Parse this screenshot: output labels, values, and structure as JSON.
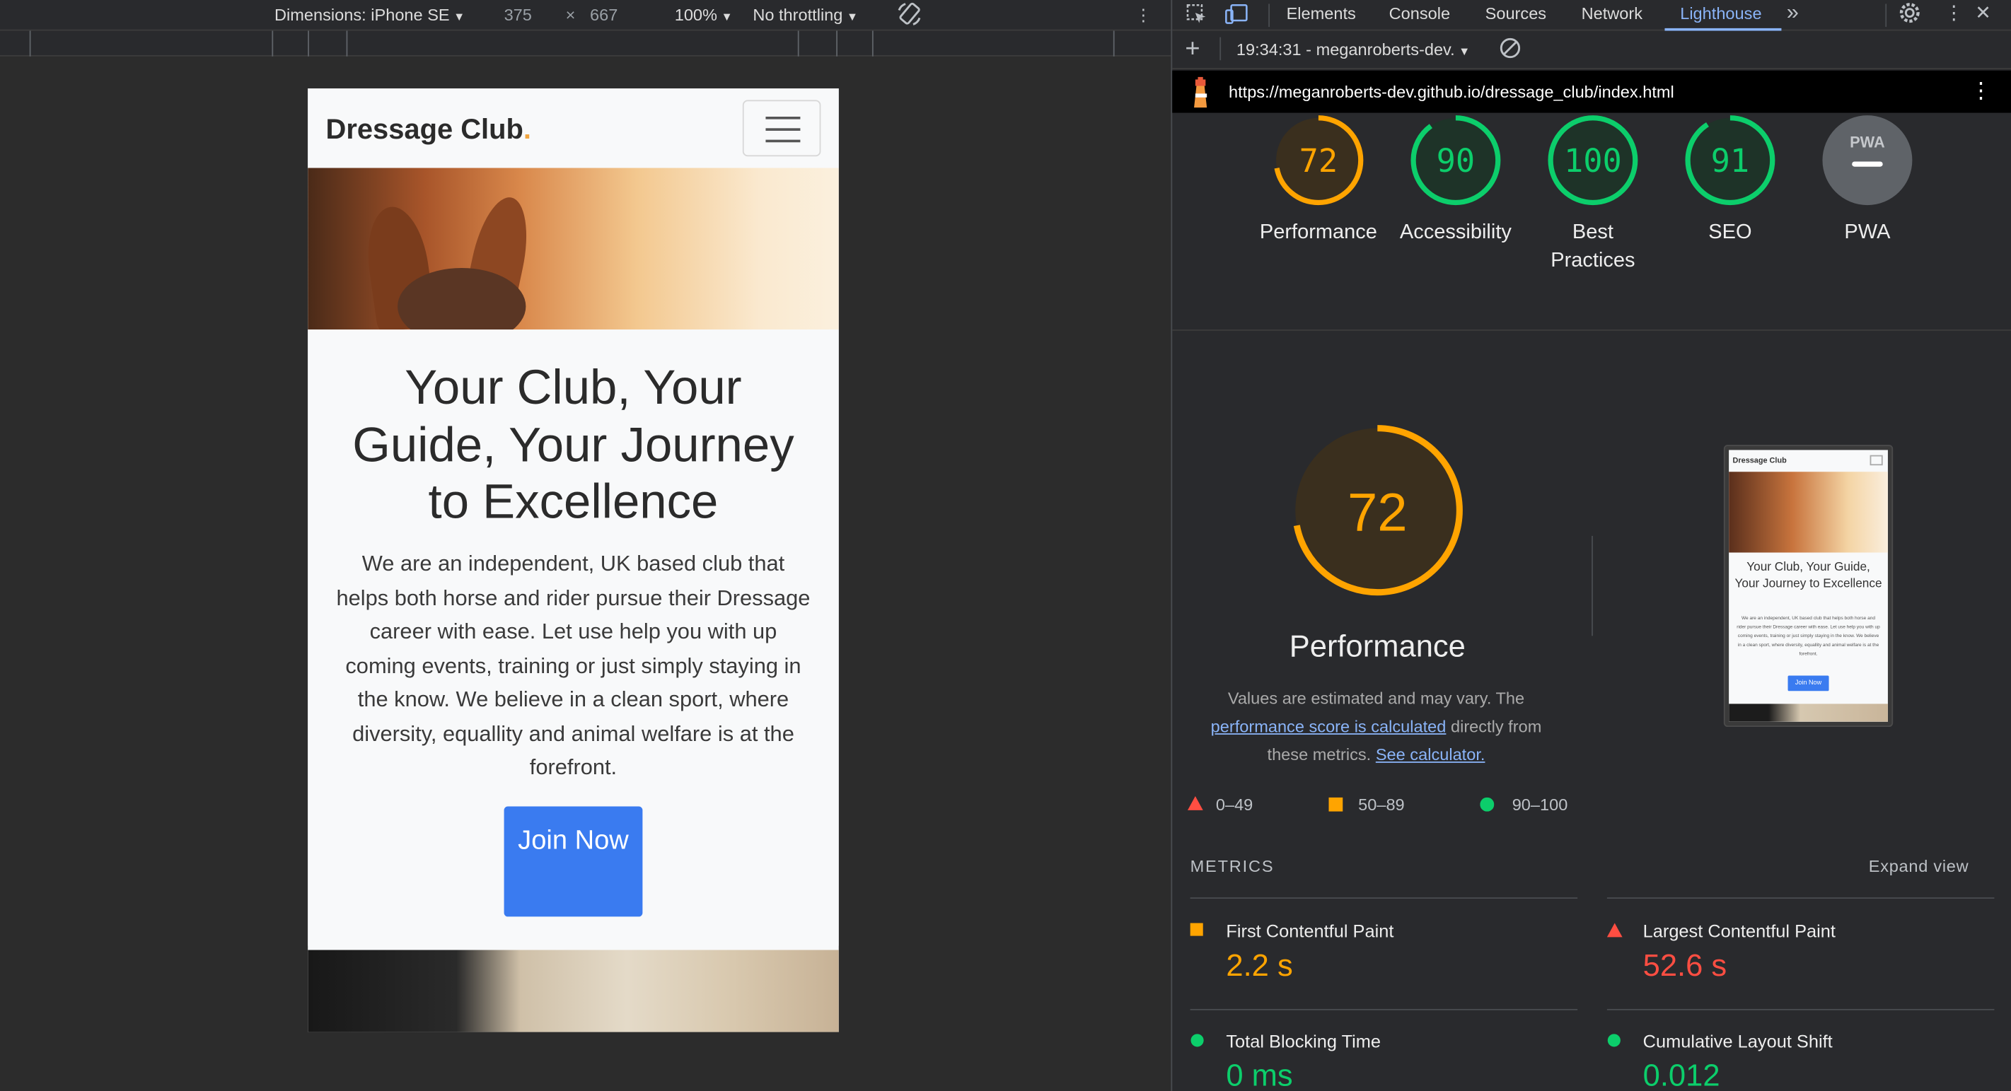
{
  "device_toolbar": {
    "dimensions_label": "Dimensions: iPhone SE",
    "width": "375",
    "times": "×",
    "height": "667",
    "zoom": "100%",
    "throttling": "No throttling"
  },
  "site": {
    "brand": "Dressage Club",
    "brand_dot": ".",
    "heading": "Your Club, Your Guide, Your Journey to Excellence",
    "intro": "We are an independent, UK based club that helps both horse and rider pursue their Dressage career with ease. Let use help you with up coming events, training or just simply staying in the know. We believe in a clean sport, where diversity, equallity and animal welfare is at the forefront.",
    "join_button": "Join Now"
  },
  "devtools": {
    "tabs": [
      "Elements",
      "Console",
      "Sources",
      "Network",
      "Lighthouse"
    ],
    "more_tabs": "»",
    "report_time": "19:34:31 - meganroberts-dev.",
    "url": "https://meganroberts-dev.github.io/dressage_club/index.html",
    "categories": [
      {
        "label": "Performance",
        "score": "72",
        "value": 72,
        "color": "#ffa400"
      },
      {
        "label": "Accessibility",
        "score": "90",
        "value": 90,
        "color": "#0cce6b"
      },
      {
        "label": "Best Practices",
        "score": "100",
        "value": 100,
        "color": "#0cce6b"
      },
      {
        "label": "SEO",
        "score": "91",
        "value": 91,
        "color": "#0cce6b"
      },
      {
        "label": "PWA",
        "score": "",
        "value": 0,
        "color": "#9aa0a6"
      }
    ],
    "pwa_badge": "PWA",
    "performance": {
      "score": "72",
      "value": 72,
      "title": "Performance",
      "desc_start": "Values are estimated and may vary. The",
      "desc_link": "performance score is calculated",
      "desc_mid": "directly from these metrics.",
      "desc_link2": "See calculator."
    },
    "thumbnail": {
      "brand": "Dressage Club",
      "heading": "Your Club, Your Guide, Your Journey to Excellence",
      "button": "Join Now"
    },
    "legend": [
      {
        "range": "0–49",
        "color": "#ff4e42",
        "shape": "triangle"
      },
      {
        "range": "50–89",
        "color": "#ffa400",
        "shape": "square"
      },
      {
        "range": "90–100",
        "color": "#0cce6b",
        "shape": "circle"
      }
    ],
    "metrics_heading": "METRICS",
    "expand_view": "Expand view",
    "metrics": [
      {
        "name": "First Contentful Paint",
        "value": "2.2 s",
        "color": "#ffa400",
        "shape": "square"
      },
      {
        "name": "Largest Contentful Paint",
        "value": "52.6 s",
        "color": "#ff4e42",
        "shape": "triangle"
      },
      {
        "name": "Total Blocking Time",
        "value": "0 ms",
        "color": "#0cce6b",
        "shape": "circle"
      },
      {
        "name": "Cumulative Layout Shift",
        "value": "0.012",
        "color": "#0cce6b",
        "shape": "circle"
      }
    ]
  }
}
